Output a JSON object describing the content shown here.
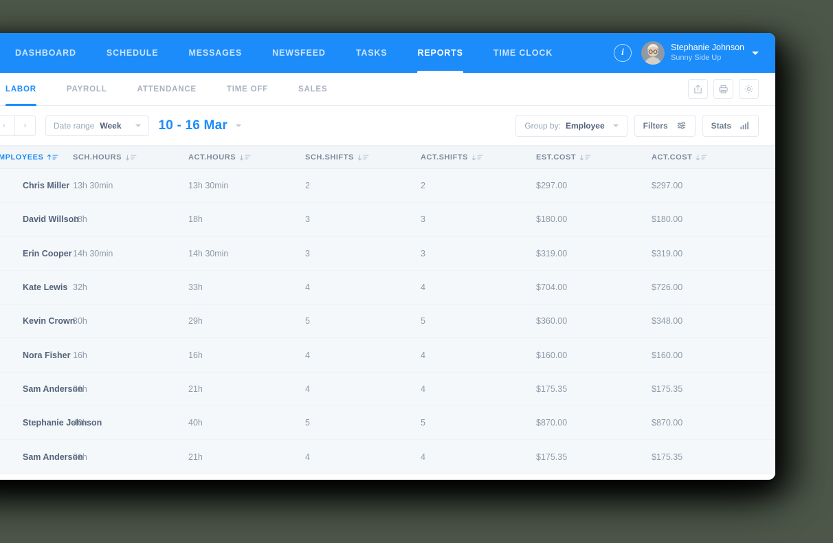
{
  "app": {
    "brand_logo": "company-logo",
    "background_color": "#4c5749",
    "accent_color": "#1b8cfa"
  },
  "top_nav": {
    "items": [
      {
        "label": "DASHBOARD",
        "active": false
      },
      {
        "label": "SCHEDULE",
        "active": false
      },
      {
        "label": "MESSAGES",
        "active": false
      },
      {
        "label": "NEWSFEED",
        "active": false
      },
      {
        "label": "TASKS",
        "active": false
      },
      {
        "label": "REPORTS",
        "active": true
      },
      {
        "label": "TIME CLOCK",
        "active": false
      }
    ],
    "info_icon": "info-icon",
    "user": {
      "name": "Stephanie Johnson",
      "company": "Sunny Side Up"
    }
  },
  "sub_nav": {
    "items": [
      {
        "label": "LABOR",
        "active": true
      },
      {
        "label": "PAYROLL",
        "active": false
      },
      {
        "label": "ATTENDANCE",
        "active": false
      },
      {
        "label": "TIME OFF",
        "active": false
      },
      {
        "label": "SALES",
        "active": false
      }
    ],
    "actions": [
      {
        "icon": "export-icon"
      },
      {
        "icon": "print-icon"
      },
      {
        "icon": "gear-icon"
      }
    ]
  },
  "toolbar": {
    "prev_label": "‹",
    "next_label": "›",
    "date_range_label": "Date range",
    "date_range_value": "Week",
    "date_display": "10 - 16 Mar",
    "group_by_label": "Group by:",
    "group_by_value": "Employee",
    "filters_label": "Filters",
    "stats_label": "Stats"
  },
  "table": {
    "columns": [
      {
        "label": "EMPLOYEES",
        "sort": "asc",
        "sorted": true
      },
      {
        "label": "SCH.HOURS",
        "sort": "desc",
        "sorted": false
      },
      {
        "label": "ACT.HOURS",
        "sort": "desc",
        "sorted": false
      },
      {
        "label": "SCH.SHIFTS",
        "sort": "desc",
        "sorted": false
      },
      {
        "label": "ACT.SHIFTS",
        "sort": "desc",
        "sorted": false
      },
      {
        "label": "EST.COST",
        "sort": "desc",
        "sorted": false
      },
      {
        "label": "ACT.COST",
        "sort": "desc",
        "sorted": false
      }
    ],
    "rows": [
      {
        "employee": "Chris Miller",
        "sch_hours": "13h 30min",
        "act_hours": "13h 30min",
        "sch_shifts": "2",
        "act_shifts": "2",
        "est_cost": "$297.00",
        "act_cost": "$297.00",
        "avatar_bg": "#e8b894",
        "avatar_hair": "#2e2420"
      },
      {
        "employee": "David Willson",
        "sch_hours": "18h",
        "act_hours": "18h",
        "sch_shifts": "3",
        "act_shifts": "3",
        "est_cost": "$180.00",
        "act_cost": "$180.00",
        "avatar_bg": "#b9c2cc",
        "avatar_hair": "#3a3a3a"
      },
      {
        "employee": "Erin Cooper",
        "sch_hours": "14h 30min",
        "act_hours": "14h 30min",
        "sch_shifts": "3",
        "act_shifts": "3",
        "est_cost": "$319.00",
        "act_cost": "$319.00",
        "avatar_bg": "#2e7bb5",
        "avatar_hair": "#d8c39f"
      },
      {
        "employee": "Kate Lewis",
        "sch_hours": "32h",
        "act_hours": "33h",
        "sch_shifts": "4",
        "act_shifts": "4",
        "est_cost": "$704.00",
        "act_cost": "$726.00",
        "avatar_bg": "#aab7c4",
        "avatar_hair": "#2b2420"
      },
      {
        "employee": "Kevin Crown",
        "sch_hours": "30h",
        "act_hours": "29h",
        "sch_shifts": "5",
        "act_shifts": "5",
        "est_cost": "$360.00",
        "act_cost": "$348.00",
        "avatar_bg": "#4c4540",
        "avatar_hair": "#1d1a18"
      },
      {
        "employee": "Nora Fisher",
        "sch_hours": "16h",
        "act_hours": "16h",
        "sch_shifts": "4",
        "act_shifts": "4",
        "est_cost": "$160.00",
        "act_cost": "$160.00",
        "avatar_bg": "#2f6ea8",
        "avatar_hair": "#3c2c22"
      },
      {
        "employee": "Sam Anderson",
        "sch_hours": "21h",
        "act_hours": "21h",
        "sch_shifts": "4",
        "act_shifts": "4",
        "est_cost": "$175.35",
        "act_cost": "$175.35",
        "avatar_bg": "#c8cdd4",
        "avatar_hair": "#2a2portal"
      },
      {
        "employee": "Stephanie Johnson",
        "sch_hours": "40h",
        "act_hours": "40h",
        "sch_shifts": "5",
        "act_shifts": "5",
        "est_cost": "$870.00",
        "act_cost": "$870.00",
        "avatar_bg": "#d9d3c8",
        "avatar_hair": "#6b5a46"
      },
      {
        "employee": "Sam Anderson",
        "sch_hours": "21h",
        "act_hours": "21h",
        "sch_shifts": "4",
        "act_shifts": "4",
        "est_cost": "$175.35",
        "act_cost": "$175.35",
        "avatar_bg": "#2e8ec4",
        "avatar_hair": "#3a3024"
      }
    ]
  }
}
